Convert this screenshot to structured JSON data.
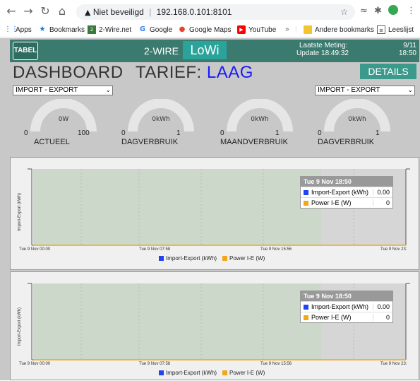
{
  "browser": {
    "security_label": "Niet beveiligd",
    "url": "192.168.0.101:8101",
    "nav_icons": [
      "back-arrow-icon",
      "forward-arrow-icon",
      "reload-icon",
      "home-icon"
    ],
    "bookmarks": [
      "Apps",
      "Bookmarks",
      "2-Wire.net",
      "Google",
      "Google Maps",
      "YouTube"
    ],
    "other_bookmarks": "Andere bookmarks",
    "reading_list": "Leeslijst"
  },
  "topbar": {
    "tabel_label": "TABEL",
    "wire_label": "2-WIRE",
    "lowi_label": "LoWi",
    "laatste_meting": "Laatste Meting:",
    "update_text": "Update 18:49:32",
    "date": "9/11",
    "time": "18:50"
  },
  "dashboard": {
    "title": "DASHBOARD",
    "tarief_label": "TARIEF:",
    "tarief_value": "LAAG",
    "details_label": "DETAILS",
    "select_left": "IMPORT - EXPORT",
    "select_right": "IMPORT - EXPORT"
  },
  "gauges": [
    {
      "value": "0W",
      "min": "0",
      "max": "100",
      "label": "ACTUEEL",
      "fill": 0
    },
    {
      "value": "0kWh",
      "min": "0",
      "max": "1",
      "label": "DAGVERBRUIK",
      "fill": 0
    },
    {
      "value": "0kWh",
      "min": "0",
      "max": "1",
      "label": "MAANDVERBRUIK",
      "fill": 0
    },
    {
      "value": "0kWh",
      "min": "0",
      "max": "1",
      "label": "DAGVERBRUIK",
      "fill": 0
    }
  ],
  "charts": [
    {
      "ylabel": "Import-Export (kWh)",
      "x_ticks": [
        "Tue 9 Nov 00:00",
        "Tue 9 Nov 07:58",
        "Tue 9 Nov 15:56",
        "Tue 9 Nov 23:"
      ],
      "tooltip": {
        "header": "Tue 9 Nov 18:50",
        "rows": [
          {
            "name": "Import-Export (kWh)",
            "value": "0.00"
          },
          {
            "name": "Power I-E (W)",
            "value": "0"
          }
        ]
      },
      "legend": [
        "Import-Export (kWh)",
        "Power I-E (W)"
      ]
    },
    {
      "ylabel": "Import-Export (kWh)",
      "x_ticks": [
        "Tue 9 Nov 00:00",
        "Tue 9 Nov 07:58",
        "Tue 9 Nov 15:56",
        "Tue 9 Nov 23:"
      ],
      "tooltip": {
        "header": "Tue 9 Nov 18:50",
        "rows": [
          {
            "name": "Import-Export (kWh)",
            "value": "0.00"
          },
          {
            "name": "Power I-E (W)",
            "value": "0"
          }
        ]
      },
      "legend": [
        "Import-Export (kWh)",
        "Power I-E (W)"
      ]
    }
  ],
  "colors": {
    "series_import": "#2244ee",
    "series_power": "#f0a818",
    "topbar": "#3b7b6f",
    "accent": "#2aa39a"
  }
}
